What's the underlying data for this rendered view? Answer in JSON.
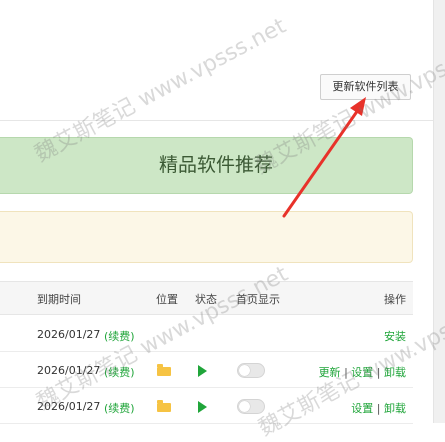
{
  "toolbar": {
    "update_label": "更新软件列表"
  },
  "banner": {
    "recommend_title": "精品软件推荐"
  },
  "table": {
    "headers": {
      "expiry": "到期时间",
      "location": "位置",
      "status": "状态",
      "homepage": "首页显示",
      "actions": "操作"
    },
    "rows": [
      {
        "date": "2026/01/27",
        "renew": "(续费)",
        "actions": [
          "安装"
        ]
      },
      {
        "date": "2026/01/27",
        "renew": "(续费)",
        "actions": [
          "更新",
          "设置",
          "卸载"
        ]
      },
      {
        "date": "2026/01/27",
        "renew": "(续费)",
        "actions": [
          "设置",
          "卸载"
        ]
      }
    ],
    "separator": "|"
  },
  "watermark": {
    "text": "魏艾斯笔记 www.vpsss.net"
  },
  "colors": {
    "green_accent": "#20a53a",
    "banner_green": "#cde7c6",
    "banner_yellow": "#fcf7e7",
    "arrow_red": "#e8322a",
    "folder_yellow": "#f6c343"
  },
  "icons": {
    "location": "folder-icon",
    "status": "play-icon",
    "homepage": "toggle-switch"
  }
}
